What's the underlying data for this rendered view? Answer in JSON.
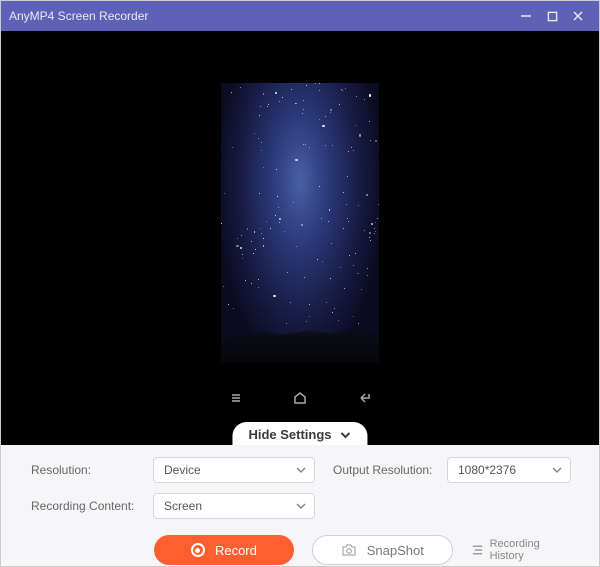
{
  "title": "AnyMP4 Screen Recorder",
  "settingsToggle": "Hide Settings",
  "labels": {
    "resolution": "Resolution:",
    "recordingContent": "Recording Content:",
    "outputResolution": "Output Resolution:"
  },
  "selects": {
    "resolution": "Device",
    "recordingContent": "Screen",
    "outputResolution": "1080*2376"
  },
  "buttons": {
    "record": "Record",
    "snapshot": "SnapShot"
  },
  "history": "Recording History"
}
